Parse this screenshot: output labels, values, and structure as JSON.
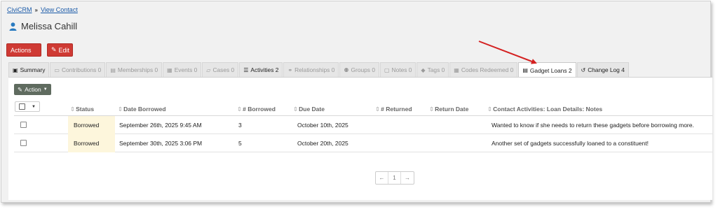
{
  "breadcrumb": {
    "root": "CiviCRM",
    "current": "View Contact"
  },
  "contact": {
    "name": "Melissa Cahill"
  },
  "buttons": {
    "actions": "Actions",
    "edit": "Edit"
  },
  "tabs": [
    {
      "label": "Summary",
      "icon": "id-card-icon",
      "glyph": "▣"
    },
    {
      "label": "Contributions 0",
      "icon": "credit-card-icon",
      "glyph": "▭"
    },
    {
      "label": "Memberships 0",
      "icon": "id-badge-icon",
      "glyph": "▤"
    },
    {
      "label": "Events 0",
      "icon": "calendar-icon",
      "glyph": "▦"
    },
    {
      "label": "Cases 0",
      "icon": "folder-icon",
      "glyph": "▱"
    },
    {
      "label": "Activities 2",
      "icon": "tasks-icon",
      "glyph": "☰"
    },
    {
      "label": "Relationships 0",
      "icon": "handshake-icon",
      "glyph": "⚭"
    },
    {
      "label": "Groups 0",
      "icon": "users-icon",
      "glyph": "⚉"
    },
    {
      "label": "Notes 0",
      "icon": "sticky-note-icon",
      "glyph": "▢"
    },
    {
      "label": "Tags 0",
      "icon": "tag-icon",
      "glyph": "◆"
    },
    {
      "label": "Codes Redeemed 0",
      "icon": "grid-icon",
      "glyph": "▦"
    },
    {
      "label": "Gadget Loans 2",
      "icon": "list-alt-icon",
      "glyph": "▤"
    },
    {
      "label": "Change Log 4",
      "icon": "history-icon",
      "glyph": "↺"
    }
  ],
  "action_menu": {
    "label": "Action"
  },
  "table": {
    "headers": [
      "Status",
      "Date Borrowed",
      "# Borrowed",
      "Due Date",
      "# Returned",
      "Return Date",
      "Contact Activities: Loan Details: Notes"
    ],
    "rows": [
      {
        "status": "Borrowed",
        "date_borrowed": "September 26th, 2025 9:45 AM",
        "borrowed": "3",
        "due_date": "October 10th, 2025",
        "returned": "",
        "return_date": "",
        "notes": "Wanted to know if she needs to return these gadgets before borrowing more."
      },
      {
        "status": "Borrowed",
        "date_borrowed": "September 30th, 2025 3:06 PM",
        "borrowed": "5",
        "due_date": "October 20th, 2025",
        "returned": "",
        "return_date": "",
        "notes": "Another set of gadgets successfully loaned to a constituent!"
      }
    ]
  },
  "pager": {
    "prev": "←",
    "page": "1",
    "next": "→"
  },
  "colors": {
    "red_button": "#cf3a34",
    "link": "#1a5aa8",
    "status_highlight": "#fdf6dc",
    "annotation_arrow": "#d42020"
  }
}
